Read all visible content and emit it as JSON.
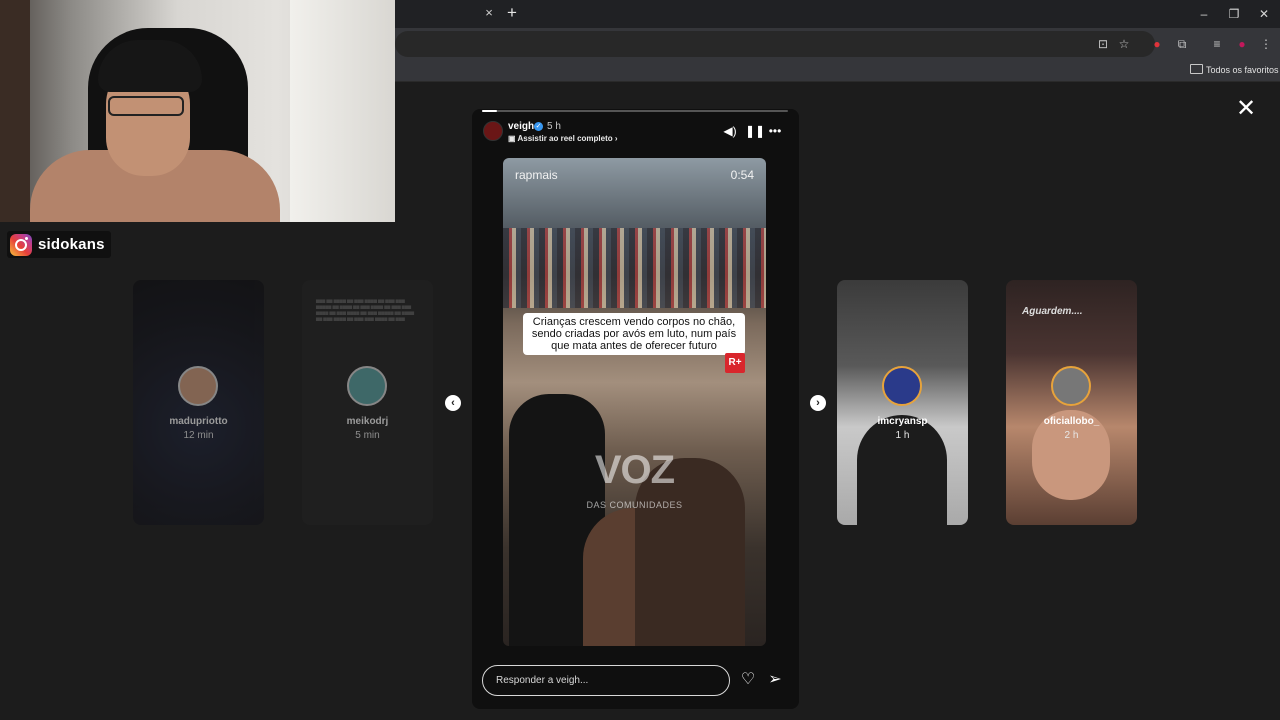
{
  "browser": {
    "tab_close": "×",
    "tab_new": "+",
    "window_controls": {
      "minimize": "–",
      "maximize": "❐",
      "close": "✕"
    },
    "toolbar_icons": [
      "install-icon",
      "star-icon",
      "extension-red-icon",
      "puzzle-icon",
      "media-icon",
      "profile-icon",
      "menu-icon"
    ],
    "bookmarks_label": "Todos os favoritos"
  },
  "webcam": {
    "handle": "sidokans"
  },
  "previews": [
    {
      "user": "madupriotto",
      "time": "12 min"
    },
    {
      "user": "meikodrj",
      "time": "5 min"
    },
    {
      "user": "imcryansp",
      "time": "1 h"
    },
    {
      "user": "oficiallobo_",
      "time": "2 h",
      "tag": "Aguardem...."
    }
  ],
  "story": {
    "user": "veigh",
    "time": "5 h",
    "reel_link": "Assistir ao reel completo",
    "progress": 0.05,
    "video": {
      "brand": "rapmais",
      "duration": "0:54",
      "caption": "Crianças crescem vendo corpos no chão, sendo criadas por avós em luto, num país que mata antes de oferecer futuro",
      "badge": "R+",
      "watermark_main": "VOZ",
      "watermark_sub": "DAS COMUNIDADES"
    },
    "reply_placeholder": "Responder a veigh..."
  },
  "colors": {
    "background": "#1c1c1c",
    "story_bg": "#0f0f0f",
    "verified": "#3897f0",
    "rplus": "#d9262c"
  }
}
